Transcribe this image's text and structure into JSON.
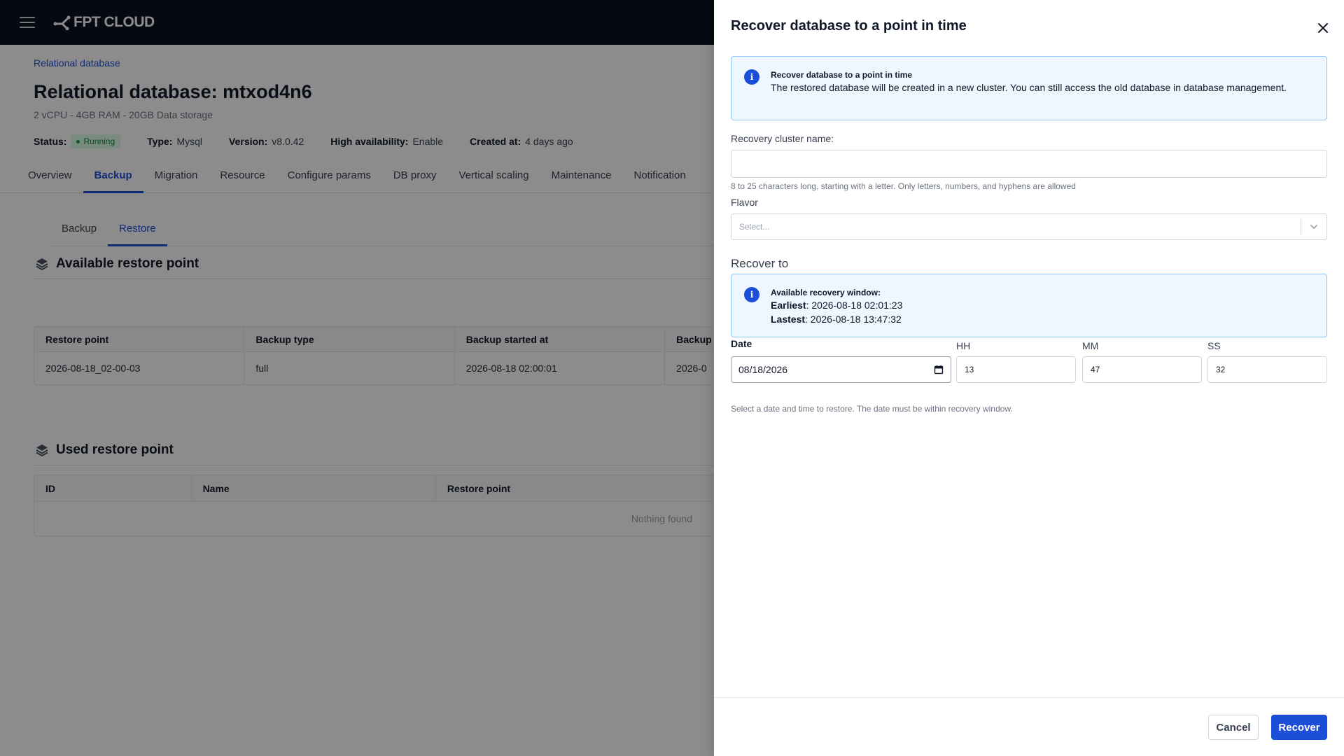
{
  "app": {
    "logo_text": "FPT CLOUD"
  },
  "page": {
    "breadcrumb": "Relational database",
    "title": "Relational database: mtxod4n6",
    "subtitle": "2 vCPU - 4GB RAM - 20GB Data storage",
    "meta": {
      "status_label": "Status:",
      "status_value": "Running",
      "type_label": "Type:",
      "type_value": "Mysql",
      "version_label": "Version:",
      "version_value": "v8.0.42",
      "ha_label": "High availability:",
      "ha_value": "Enable",
      "created_label": "Created at:",
      "created_value": "4 days ago"
    },
    "tabs": [
      "Overview",
      "Backup",
      "Migration",
      "Resource",
      "Configure params",
      "DB proxy",
      "Vertical scaling",
      "Maintenance",
      "Notification"
    ],
    "active_tab": "Backup",
    "subtabs": [
      "Backup",
      "Restore"
    ],
    "active_subtab": "Restore",
    "available": {
      "title": "Available restore point",
      "columns": [
        "Restore point",
        "Backup type",
        "Backup started at",
        "Backup"
      ],
      "rows": [
        [
          "2026-08-18_02-00-03",
          "full",
          "2026-08-18 02:00:01",
          "2026-0"
        ]
      ]
    },
    "used": {
      "title": "Used restore point",
      "columns": [
        "ID",
        "Name",
        "Restore point"
      ],
      "empty_text": "Nothing found"
    }
  },
  "drawer": {
    "title": "Recover database to a point in time",
    "info": {
      "heading": "Recover database to a point in time",
      "text": "The restored database will be created in a new cluster. You can still access the old database in database management."
    },
    "cluster_name": {
      "label": "Recovery cluster name:",
      "value": "",
      "hint": "8 to 25 characters long, starting with a letter. Only letters, numbers, and hyphens are allowed"
    },
    "flavor": {
      "label": "Flavor",
      "placeholder": "Select..."
    },
    "recover_to_label": "Recover to",
    "window": {
      "heading": "Available recovery window:",
      "earliest_label": "Earliest",
      "earliest_value": ": 2026-08-18 02:01:23",
      "lastest_label": "Lastest",
      "lastest_value": ": 2026-08-18 13:47:32"
    },
    "date": {
      "label": "Date",
      "value": "08/18/2026"
    },
    "hh": {
      "label": "HH",
      "value": "13"
    },
    "mm": {
      "label": "MM",
      "value": "47"
    },
    "ss": {
      "label": "SS",
      "value": "32"
    },
    "datetime_hint": "Select a date and time to restore. The date must be within recovery window.",
    "cancel_label": "Cancel",
    "recover_label": "Recover"
  },
  "colors": {
    "primary": "#1d4ed8",
    "topbar": "#0b1220",
    "info_bg": "#eef6ff",
    "overlay": "rgba(0,0,0,0.45)"
  }
}
